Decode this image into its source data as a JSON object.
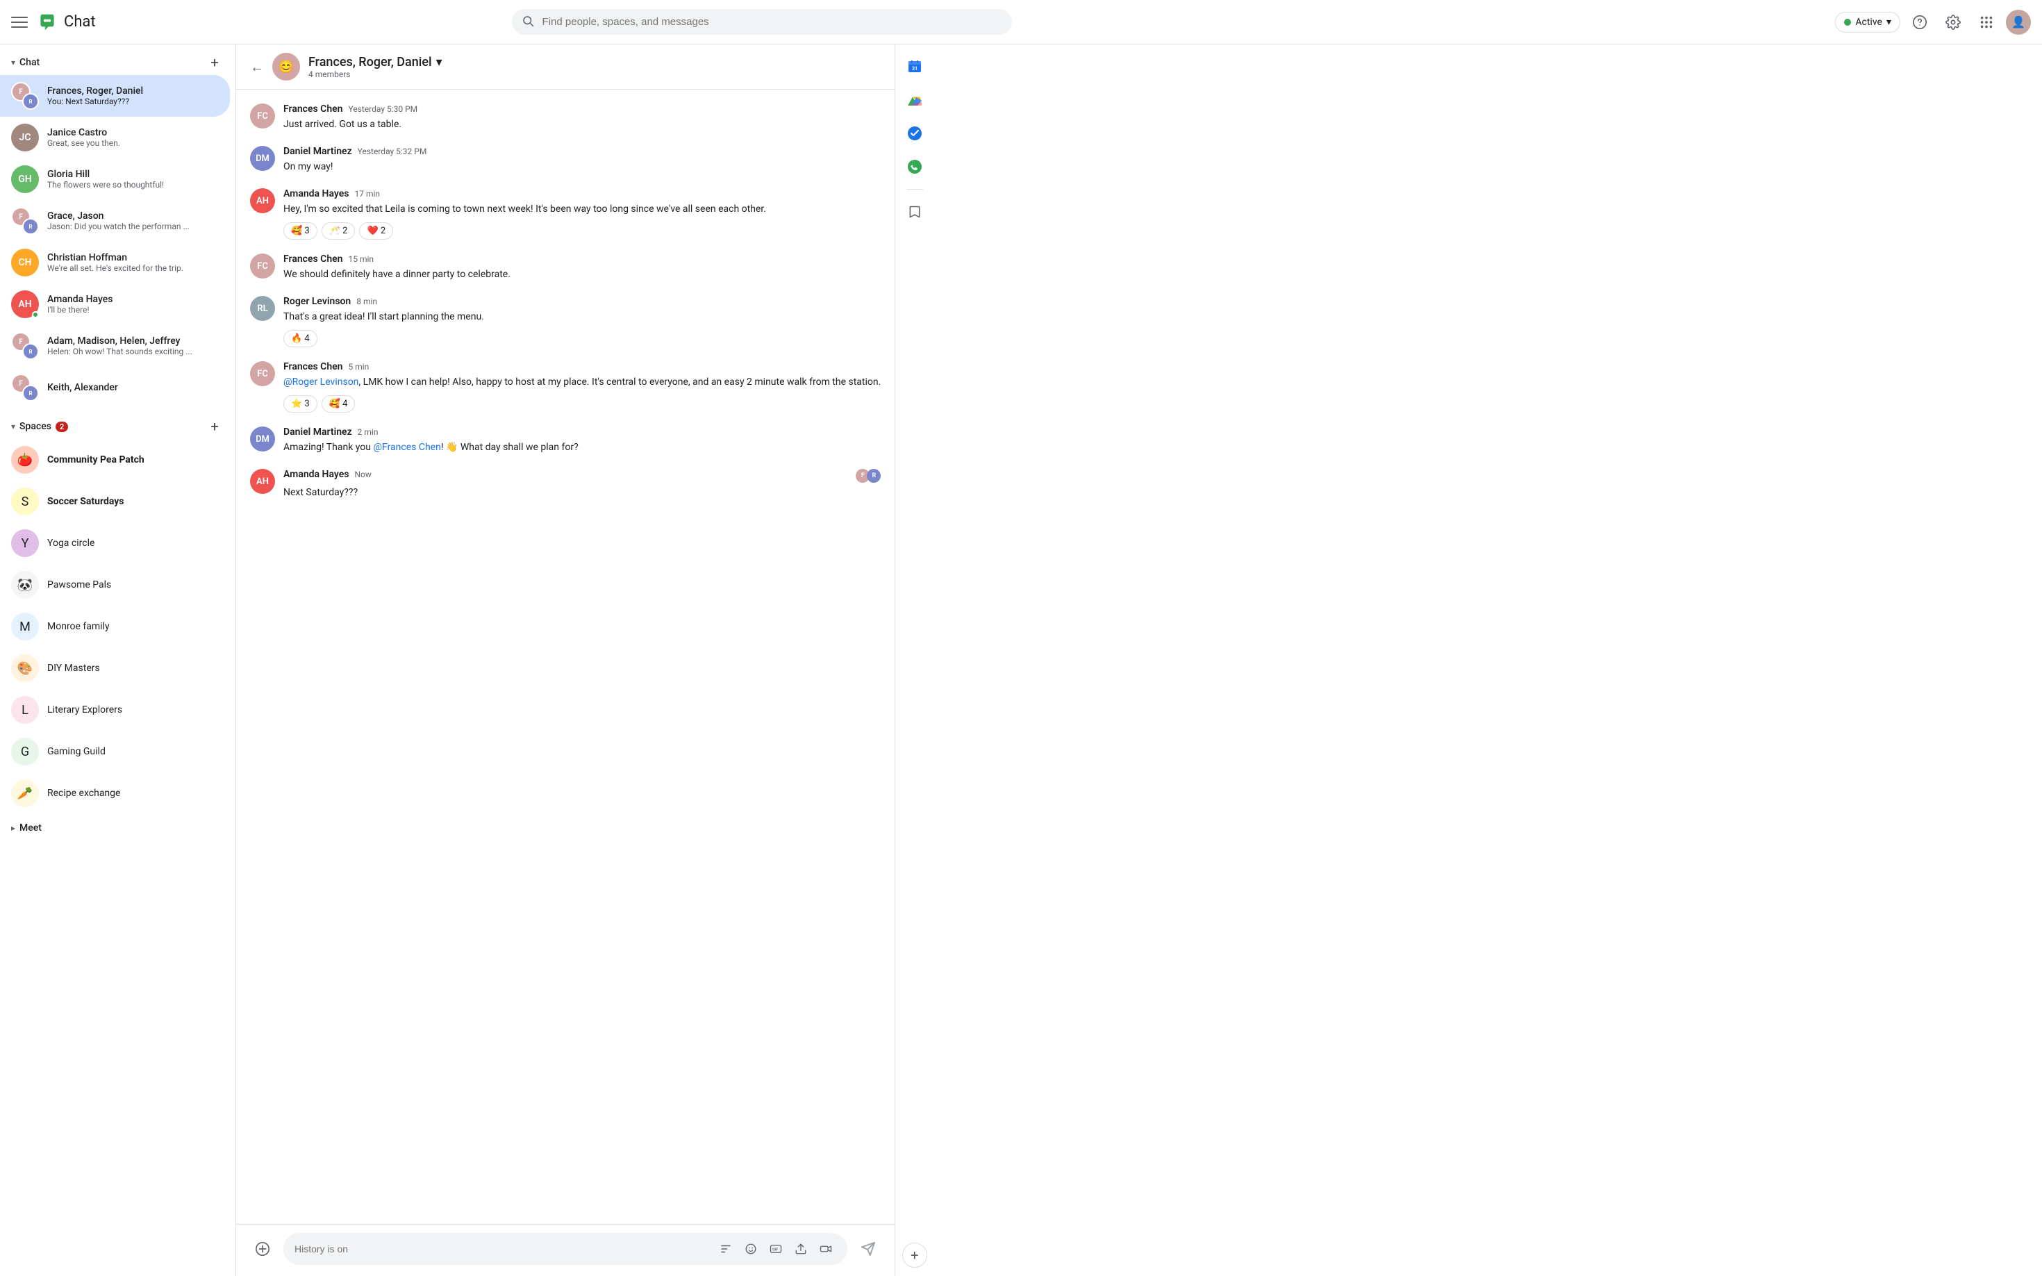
{
  "app": {
    "title": "Chat",
    "logo_color": "#34a853"
  },
  "topbar": {
    "search_placeholder": "Find people, spaces, and messages",
    "status_label": "Active",
    "status_color": "#34a853"
  },
  "sidebar": {
    "chat_section": "Chat",
    "spaces_section": "Spaces",
    "spaces_badge": "2",
    "meet_section": "Meet",
    "chats": [
      {
        "id": 1,
        "name": "Frances, Roger, Daniel",
        "preview": "You: Next Saturday???",
        "active": true,
        "avatar_type": "group"
      },
      {
        "id": 2,
        "name": "Janice Castro",
        "preview": "Great, see you then.",
        "active": false,
        "avatar_type": "single"
      },
      {
        "id": 3,
        "name": "Gloria Hill",
        "preview": "The flowers were so thoughtful!",
        "active": false,
        "avatar_type": "single"
      },
      {
        "id": 4,
        "name": "Grace, Jason",
        "preview": "Jason: Did you watch the performan ...",
        "active": false,
        "avatar_type": "group"
      },
      {
        "id": 5,
        "name": "Christian Hoffman",
        "preview": "We're all set.  He's excited for the trip.",
        "active": false,
        "avatar_type": "single"
      },
      {
        "id": 6,
        "name": "Amanda Hayes",
        "preview": "I'll be there!",
        "active": false,
        "avatar_type": "single"
      },
      {
        "id": 7,
        "name": "Adam, Madison, Helen, Jeffrey",
        "preview": "Helen: Oh wow! That sounds exciting ...",
        "active": false,
        "avatar_type": "group"
      },
      {
        "id": 8,
        "name": "Keith, Alexander",
        "preview": "",
        "active": false,
        "avatar_type": "group"
      }
    ],
    "spaces": [
      {
        "id": 1,
        "name": "Community Pea Patch",
        "icon": "🍅",
        "bold": true,
        "bg": "#ffccbc"
      },
      {
        "id": 2,
        "name": "Soccer Saturdays",
        "icon": "S",
        "bold": true,
        "bg": "#fff9c4"
      },
      {
        "id": 3,
        "name": "Yoga circle",
        "icon": "Y",
        "bold": false,
        "bg": "#e1bee7"
      },
      {
        "id": 4,
        "name": "Pawsome Pals",
        "icon": "🐼",
        "bold": false,
        "bg": "#f5f5f5"
      },
      {
        "id": 5,
        "name": "Monroe family",
        "icon": "M",
        "bold": false,
        "bg": "#e3f2fd"
      },
      {
        "id": 6,
        "name": "DIY Masters",
        "icon": "🎨",
        "bold": false,
        "bg": "#fff3e0"
      },
      {
        "id": 7,
        "name": "Literary Explorers",
        "icon": "L",
        "bold": false,
        "bg": "#fce4ec"
      },
      {
        "id": 8,
        "name": "Gaming Guild",
        "icon": "G",
        "bold": false,
        "bg": "#e8f5e9"
      },
      {
        "id": 9,
        "name": "Recipe exchange",
        "icon": "🥕",
        "bold": false,
        "bg": "#fff8e1"
      }
    ]
  },
  "chat_header": {
    "name": "Frances, Roger, Daniel",
    "members": "4 members",
    "chevron": "▾"
  },
  "messages": [
    {
      "id": 1,
      "sender": "Frances Chen",
      "time": "Yesterday 5:30 PM",
      "text": "Just arrived.  Got us a table.",
      "reactions": [],
      "avatar_color": "av-pink"
    },
    {
      "id": 2,
      "sender": "Daniel Martinez",
      "time": "Yesterday 5:32 PM",
      "text": "On my way!",
      "reactions": [],
      "avatar_color": "av-blue"
    },
    {
      "id": 3,
      "sender": "Amanda Hayes",
      "time": "17 min",
      "text": "Hey, I'm so excited that Leila is coming to town next week! It's been way too long since we've all seen each other.",
      "reactions": [
        {
          "emoji": "🥰",
          "count": "3"
        },
        {
          "emoji": "🥂",
          "count": "2"
        },
        {
          "emoji": "❤️",
          "count": "2"
        }
      ],
      "avatar_color": "av-red"
    },
    {
      "id": 4,
      "sender": "Frances Chen",
      "time": "15 min",
      "text": "We should definitely have a dinner party to celebrate.",
      "reactions": [],
      "avatar_color": "av-pink"
    },
    {
      "id": 5,
      "sender": "Roger Levinson",
      "time": "8 min",
      "text": "That's a great idea! I'll start planning the menu.",
      "reactions": [
        {
          "emoji": "🔥",
          "count": "4"
        }
      ],
      "avatar_color": "av-grey"
    },
    {
      "id": 6,
      "sender": "Frances Chen",
      "time": "5 min",
      "text": "@Roger Levinson, LMK how I can help!  Also, happy to host at my place. It's central to everyone, and an easy 2 minute walk from the station.",
      "mention": "@Roger Levinson",
      "reactions": [
        {
          "emoji": "⭐",
          "count": "3"
        },
        {
          "emoji": "🥰",
          "count": "4"
        }
      ],
      "avatar_color": "av-pink"
    },
    {
      "id": 7,
      "sender": "Daniel Martinez",
      "time": "2 min",
      "text": "Amazing! Thank you @Frances Chen! 👋 What day shall we plan for?",
      "mention": "@Frances Chen",
      "reactions": [],
      "avatar_color": "av-blue"
    },
    {
      "id": 8,
      "sender": "Amanda Hayes",
      "time": "Now",
      "text": "Next Saturday???",
      "reactions": [],
      "avatar_color": "av-red",
      "is_last": true
    }
  ],
  "input": {
    "placeholder": "History is on"
  },
  "right_panel": {
    "icons": [
      "calendar",
      "drive",
      "tasks",
      "phone",
      "bookmark",
      "add"
    ]
  }
}
